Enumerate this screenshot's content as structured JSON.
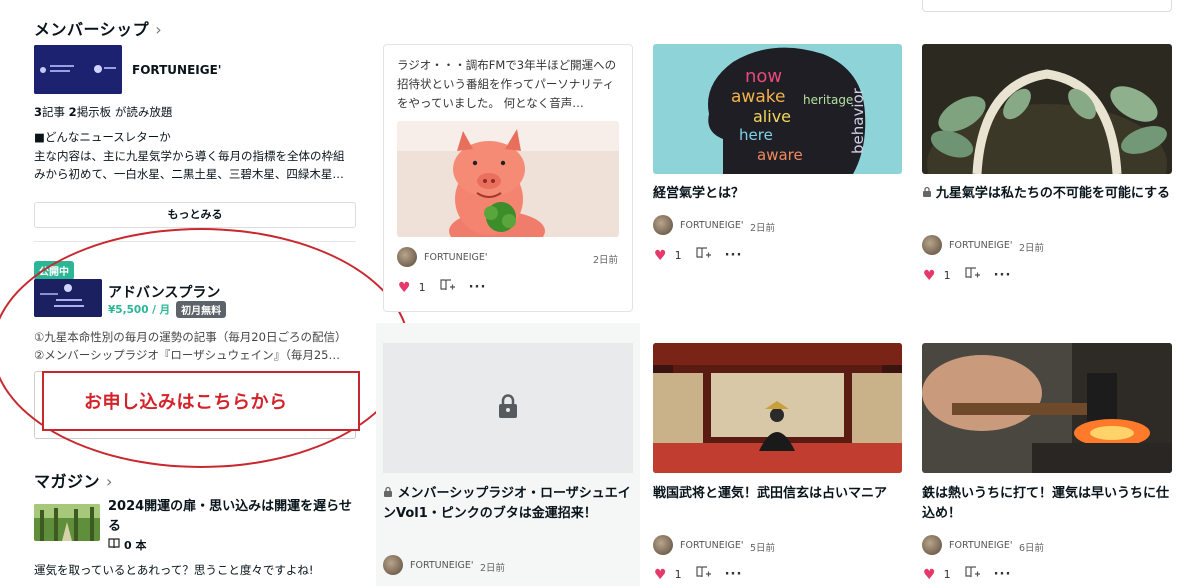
{
  "membership": {
    "heading": "メンバーシップ",
    "chevron": "›",
    "name": "FORTUNEIGE'",
    "counts": {
      "articles_num": "3",
      "articles_label": "記事 ",
      "boards_num": "2",
      "boards_label": "掲示板 が読み放題"
    },
    "desc_title": "■どんなニュースレターか",
    "desc_line1": "主な内容は、主に九星気学から導く毎月の指標を全体の枠組",
    "desc_line2": "みから初めて、一白水星、二黒土星、三碧木星、四緑木星…",
    "more_label": "もっとみる",
    "plan": {
      "status": "公開中",
      "name": "アドバンスプラン",
      "price": "¥5,500 / 月",
      "free_badge": "初月無料",
      "line1": "①九星本命性別の毎月の運勢の記事（毎月20日ごろの配信）",
      "line2": "②メンバーシップラジオ『ローザシュウェイン』（毎月25…"
    },
    "apply_label": "お申し込みはこちらから"
  },
  "magazine": {
    "heading": "マガジン",
    "chevron": "›",
    "title": "2024開運の扉・思い込みは開運を遅らせる",
    "count": "0 本",
    "excerpt": "運気を取っているとあれって？思うこと度々ですよね!"
  },
  "cards": [
    {
      "excerpt": "ラジオ・・・調布FMで3年半ほど開運への招待状という番組を作ってパーソナリティをやっていました。 何となく音声…",
      "author": "FORTUNEIGE'",
      "date": "2日前",
      "likes": "1"
    },
    {
      "title": "経営氣学とは？",
      "author": "FORTUNEIGE'",
      "date": "2日前",
      "likes": "1"
    },
    {
      "lock": "🔒",
      "title": "九星氣学は私たちの不可能を可能にする",
      "author": "FORTUNEIGE'",
      "date": "2日前",
      "likes": "1"
    },
    {
      "lock": "🔒",
      "title": "メンバーシップラジオ・ローザシュエインVol1・ピンクのブタは金運招来！",
      "author": "FORTUNEIGE'",
      "date": "2日前"
    },
    {
      "title": "戦国武将と運気！武田信玄は占いマニア",
      "author": "FORTUNEIGE'",
      "date": "5日前",
      "likes": "1"
    },
    {
      "title": "鉄は熱いうちに打て！運気は早いうちに仕込め！",
      "author": "FORTUNEIGE'",
      "date": "6日前",
      "likes": "1"
    }
  ],
  "icons": {
    "heart": "heart-icon",
    "magazine_add": "magazine-add-icon",
    "more": "more-icon",
    "lock": "lock-icon",
    "book": "book-icon"
  },
  "colors": {
    "accent_green": "#2cb696",
    "like_pink": "#e5396a",
    "annotation_red": "#c8282e"
  }
}
